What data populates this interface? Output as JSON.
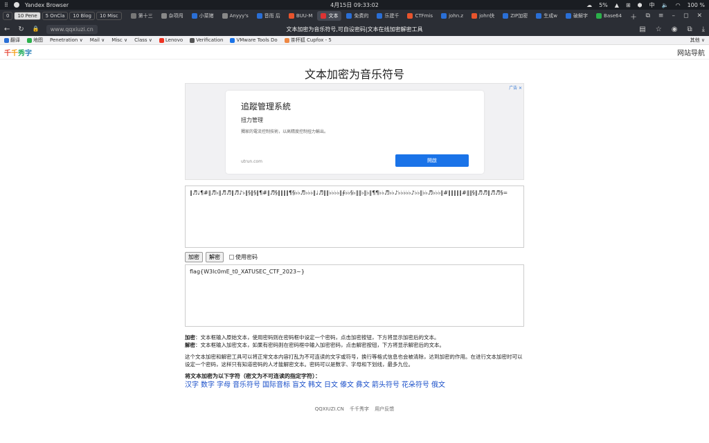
{
  "system": {
    "app": "Yandex Browser",
    "datetime": "4月15日  09:33:02",
    "battery_weather": "5%",
    "lang": "中",
    "battery": "100 %"
  },
  "workspaces": [
    {
      "label": "0",
      "active": false
    },
    {
      "label": "10 Pene",
      "active": true
    },
    {
      "label": "5 OnCla",
      "active": false
    },
    {
      "label": "10 Blog",
      "active": false
    },
    {
      "label": "10 Misc",
      "active": false
    }
  ],
  "tabs": [
    {
      "label": "第十三",
      "color": "#777",
      "active": false
    },
    {
      "label": "杂项闯",
      "color": "#888",
      "active": false
    },
    {
      "label": "小菜猪",
      "color": "#2a6fd6",
      "active": false
    },
    {
      "label": "Anyyy's",
      "color": "#888",
      "active": false
    },
    {
      "label": "音而 后",
      "color": "#2a6fd6",
      "active": false
    },
    {
      "label": "BUU-M",
      "color": "#e8542c",
      "active": false
    },
    {
      "label": "文本",
      "color": "#d33",
      "active": true
    },
    {
      "label": "免费的",
      "color": "#2a6fd6",
      "active": false
    },
    {
      "label": "乐建千",
      "color": "#2a6fd6",
      "active": false
    },
    {
      "label": "CTFmis",
      "color": "#e8542c",
      "active": false
    },
    {
      "label": "john.z",
      "color": "#2a6fd6",
      "active": false
    },
    {
      "label": "john快",
      "color": "#e8542c",
      "active": false
    },
    {
      "label": "ZIP加密",
      "color": "#2a6fd6",
      "active": false
    },
    {
      "label": "生成w",
      "color": "#2a6fd6",
      "active": false
    },
    {
      "label": "破解字",
      "color": "#2a6fd6",
      "active": false
    },
    {
      "label": "Base64",
      "color": "#2bb04a",
      "active": false
    }
  ],
  "address": {
    "url": "www.qqxiuzi.cn",
    "title": "文本加密为音乐符号,可自设密码|文本在线加密解密工具"
  },
  "bookmarks": [
    {
      "label": "翻译",
      "color": "#2a6fd6"
    },
    {
      "label": "地图",
      "color": "#2bb04a"
    },
    {
      "label": "Penetration ∨",
      "color": ""
    },
    {
      "label": "Mail ∨",
      "color": ""
    },
    {
      "label": "Misc ∨",
      "color": ""
    },
    {
      "label": "Class ∨",
      "color": ""
    },
    {
      "label": "Lenovo",
      "color": "#e32"
    },
    {
      "label": "Verification",
      "color": "#555"
    },
    {
      "label": "VMware Tools Do",
      "color": "#1a73e8"
    },
    {
      "label": "茶杯狐 Cupfox - 5",
      "color": "#e84"
    }
  ],
  "bookmarks_more": "其他 ∨",
  "site": {
    "logo": [
      "千",
      "千",
      "秀",
      "字"
    ],
    "nav": "网站导航",
    "heading": "文本加密为音乐符号"
  },
  "ad": {
    "choice": "广告 ✕",
    "title": "追蹤管理系統",
    "subtitle": "扭力管理",
    "desc": "獨家的電流控制技術，以高精度控制扭力輸出。",
    "domain": "utrun.com",
    "button": "開啟"
  },
  "encoded_text": "‖♬♩¶#‖♬♭‖♬♬‖♬♪♭‖§‖§‖¶#‖♬§‖‖‖‖¶§♭♭♬♭♭♭‖♩♬‖‖♭♭♭♭‖∮♭♭§♭‖‖♭‖♭‖¶¶♭♭♬♭♭♪♭♭♭♭♭♪♭♭‖♭♭♬♭♭♭‖#‖‖‖‖‖#‖‖§‖♬♬‖♬♬§=",
  "controls": {
    "encrypt": "加密",
    "decrypt": "解密",
    "use_password": "使用密码"
  },
  "decoded_text": "flag{W3lc0mE_t0_XATUSEC_CTF_2023~}",
  "description": {
    "encrypt_label": "加密",
    "encrypt_text": "：文本框输入原始文本，使用密码则在密码框中设定一个密码，点击加密按钮，下方将显示加密后的文本。",
    "decrypt_label": "解密",
    "decrypt_text": "：文本框输入加密文本，如果有密码则在密码框中输入加密密码，点击解密按钮，下方将显示解密后的文本。",
    "para": "这个文本加密和解密工具可以将正常文本内容打乱为不可连读的文字或符号，换行等格式信息也会被清除，达到加密的作用。在进行文本加密时可以设定一个密码，这样只有知道密码的人才能解密文本。密码可以是数字、字母和下划线，最多九位。",
    "convert_heading": "将文本加密为以下字符（密文为不可连读的指定字符）："
  },
  "convert_links": [
    "汉字",
    "数字",
    "字母",
    "音乐符号",
    "国际音标",
    "盲文",
    "韩文",
    "日文",
    "傣文",
    "彝文",
    "箭头符号",
    "花朵符号",
    "俄文"
  ],
  "footer": [
    "QQXIUZI.CN",
    "千千秀字",
    "用户反馈"
  ]
}
